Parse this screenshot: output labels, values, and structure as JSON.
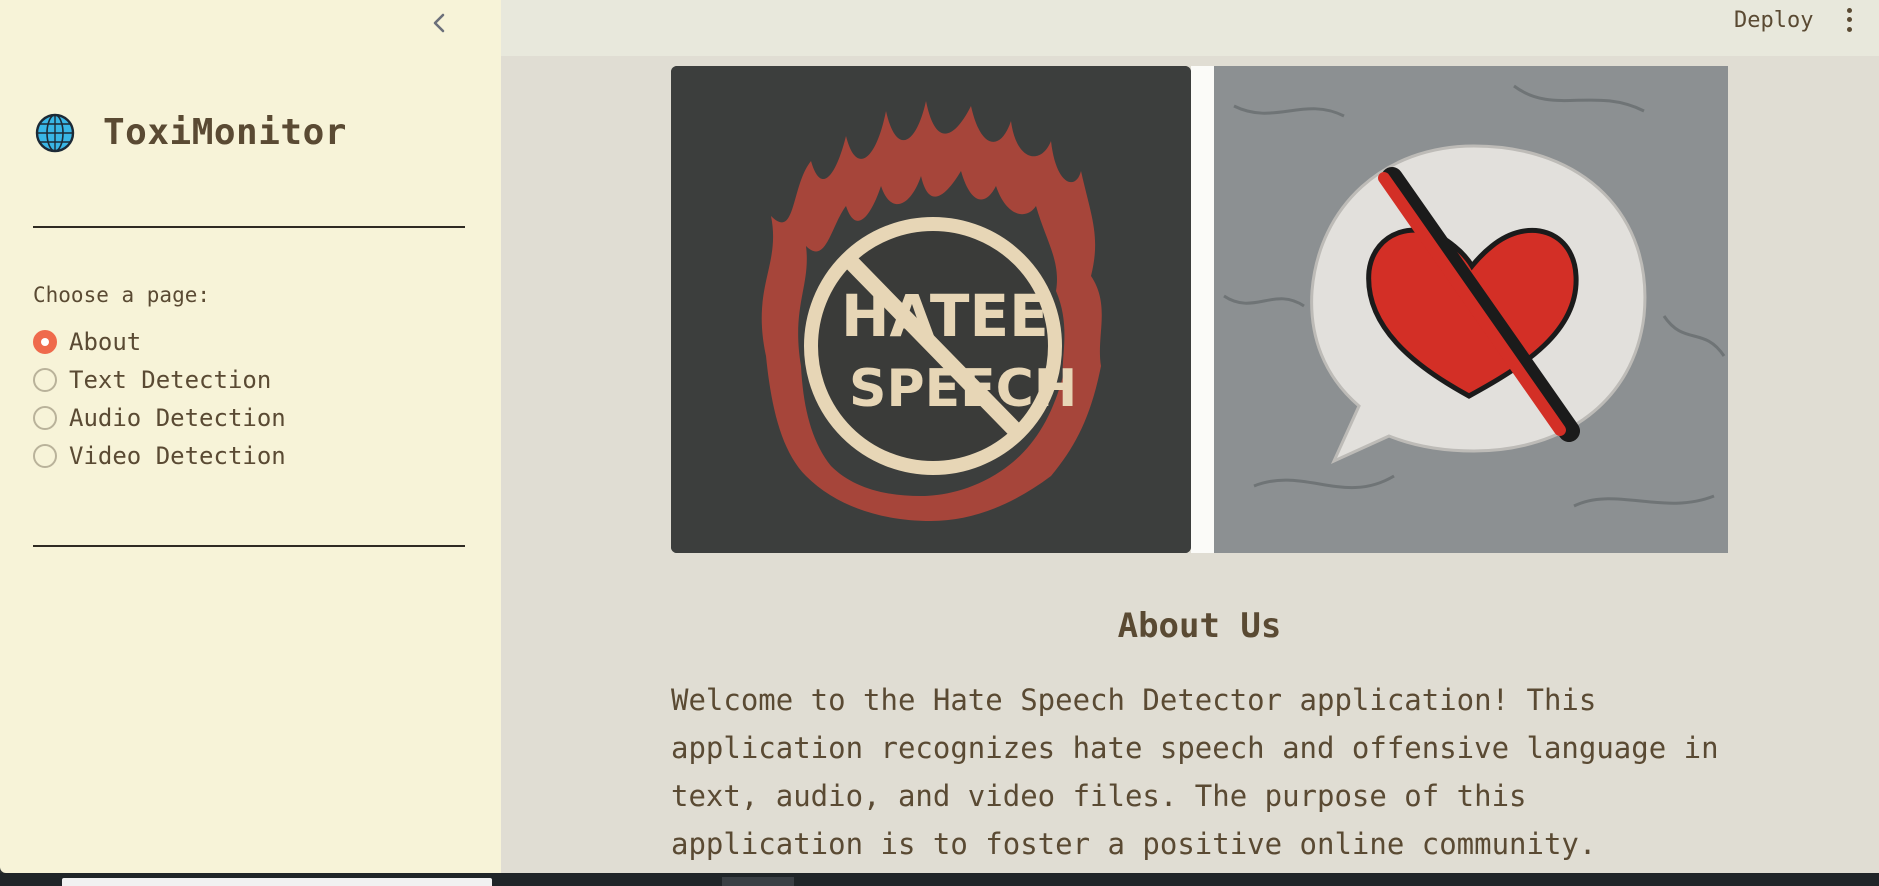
{
  "sidebar": {
    "app_title": "ToxiMonitor",
    "choose_label": "Choose a page:",
    "pages": [
      {
        "label": "About",
        "selected": true
      },
      {
        "label": "Text Detection",
        "selected": false
      },
      {
        "label": "Audio Detection",
        "selected": false
      },
      {
        "label": "Video Detection",
        "selected": false
      }
    ]
  },
  "header": {
    "deploy_label": "Deploy"
  },
  "images": {
    "left_text": [
      "HATEE",
      "SPEECH"
    ]
  },
  "main": {
    "about_title": "About Us",
    "about_text": "Welcome to the Hate Speech Detector application! This application recognizes hate speech and offensive language in text, audio, and video files. The purpose of this application is to foster a positive online community."
  },
  "colors": {
    "sidebar_bg": "#f7f3d8",
    "main_bg": "#e0ddd3",
    "header_bg": "#e8e8dc",
    "accent": "#ef6a4c",
    "text": "#5a4a33"
  }
}
